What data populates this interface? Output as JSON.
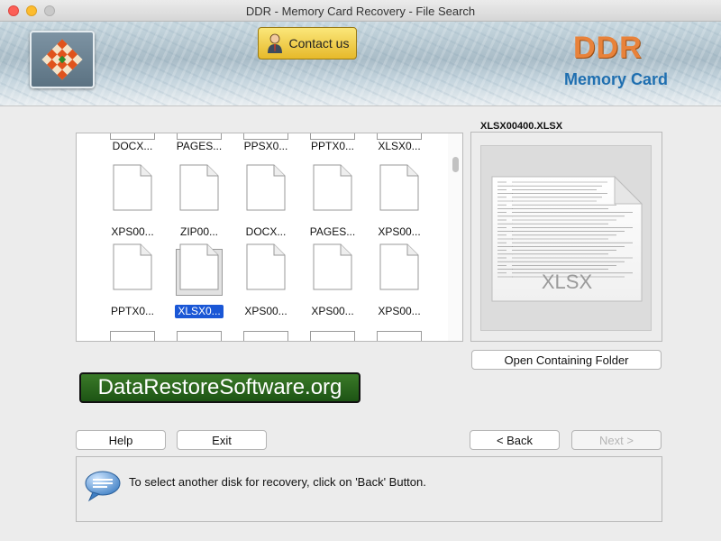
{
  "window": {
    "title": "DDR - Memory Card Recovery - File Search"
  },
  "header": {
    "contact_label": "Contact us",
    "brand_title": "DDR",
    "brand_subtitle": "Memory Card"
  },
  "file_grid": {
    "rows": [
      [
        "DOCX...",
        "PAGES...",
        "PPSX0...",
        "PPTX0...",
        "XLSX0..."
      ],
      [
        "XPS00...",
        "ZIP00...",
        "DOCX...",
        "PAGES...",
        "XPS00..."
      ],
      [
        "PPTX0...",
        "XLSX0...",
        "XPS00...",
        "XPS00...",
        "XPS00..."
      ]
    ],
    "selected": "XLSX0..."
  },
  "preview": {
    "filename": "XLSX00400.XLSX",
    "file_type": "XLSX"
  },
  "buttons": {
    "open_folder": "Open Containing Folder",
    "help": "Help",
    "exit": "Exit",
    "back": "< Back",
    "next": "Next >"
  },
  "watermark": "DataRestoreSoftware.org",
  "info": {
    "message": "To select another disk for recovery, click on 'Back' Button."
  },
  "colors": {
    "accent": "#1a57d6",
    "brand_orange": "#e8823a",
    "brand_blue": "#1f6fb0",
    "watermark_green": "#2b6a1e"
  }
}
